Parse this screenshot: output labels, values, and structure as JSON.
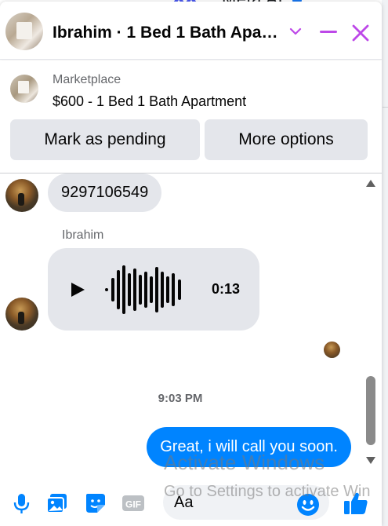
{
  "background": {
    "text": "Meta AI"
  },
  "header": {
    "title": "Ibrahim · 1 Bed 1 Bath Apa…",
    "icons": [
      "chevron-down-icon",
      "minimize-icon",
      "close-icon"
    ],
    "accent_color": "#bd48e8"
  },
  "marketplace": {
    "label": "Marketplace",
    "title": "$600 - 1 Bed 1 Bath Apartment",
    "mark_pending_label": "Mark as pending",
    "more_options_label": "More options"
  },
  "messages": {
    "phone_message": "9297106549",
    "sender_name": "Ibrahim",
    "voice_duration": "0:13",
    "timestamp": "9:03 PM",
    "outgoing_message": "Great, i will call you soon."
  },
  "composer": {
    "placeholder": "Aa",
    "icons": [
      "microphone-icon",
      "photo-icon",
      "sticker-icon",
      "gif-icon",
      "emoji-icon",
      "like-icon"
    ],
    "accent_color": "#0084ff"
  },
  "watermark": {
    "line1": "Activate Windows",
    "line2": "Go to Settings to activate Win"
  }
}
